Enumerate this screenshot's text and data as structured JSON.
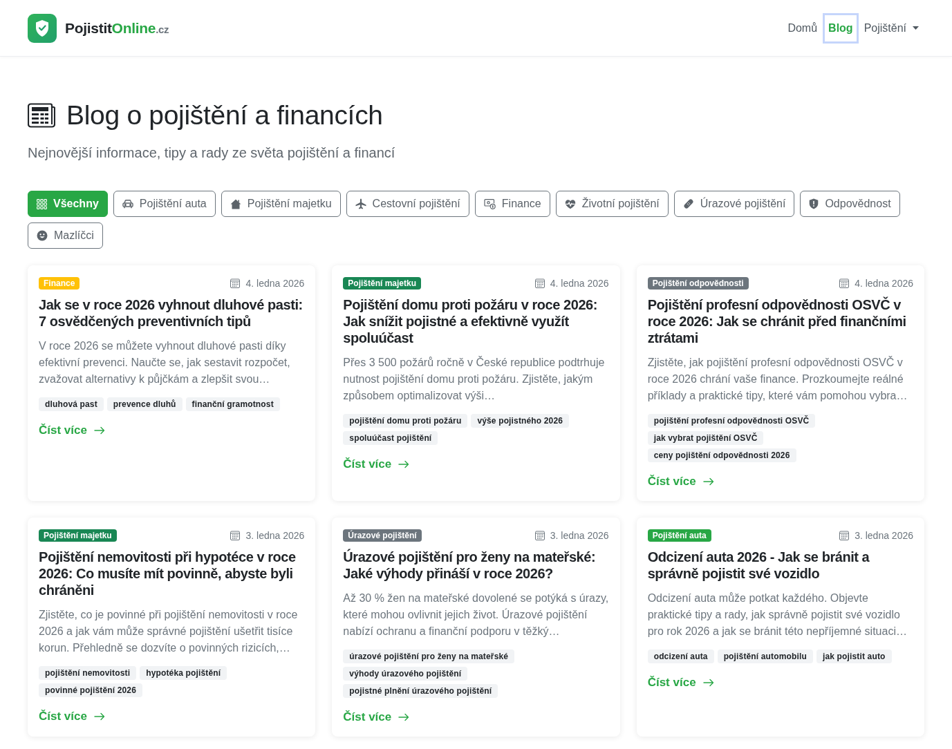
{
  "header": {
    "logo": {
      "parts": [
        {
          "text": "Pojistit",
          "kind": "plain"
        },
        {
          "text": "Online",
          "kind": "accent"
        },
        {
          "text": ".cz",
          "kind": "suffix"
        }
      ]
    },
    "nav": [
      {
        "label": "Domů",
        "kind": "link",
        "selected": false
      },
      {
        "label": "Blog",
        "kind": "link",
        "selected": true
      },
      {
        "label": "Pojištění",
        "kind": "dropdown",
        "selected": false
      }
    ]
  },
  "page": {
    "title": "Blog o pojištění a financích",
    "subtitle": "Nejnovější informace, tipy a rady ze světa pojištění a financí"
  },
  "filters": [
    {
      "label": "Všechny",
      "selected": true
    },
    {
      "label": "Pojištění auta",
      "selected": false
    },
    {
      "label": "Pojištění majetku",
      "selected": false
    },
    {
      "label": "Cestovní pojištění",
      "selected": false
    },
    {
      "label": "Finance",
      "selected": false
    },
    {
      "label": "Životní pojištění",
      "selected": false
    },
    {
      "label": "Úrazové pojištění",
      "selected": false
    },
    {
      "label": "Odpovědnost",
      "selected": false
    },
    {
      "label": "Mazlíčci",
      "selected": false
    }
  ],
  "posts": [
    {
      "category": {
        "label": "Finance",
        "color": "#ffc107"
      },
      "date": "4. ledna 2026",
      "title": "Jak se v roce 2026 vyhnout dluhové pasti: 7 osvědčených preventivních tipů",
      "excerpt": "V roce 2026 se můžete vyhnout dluhové pasti díky efektivní prevenci. Naučte se, jak sestavit rozpočet, zvažovat alternativy k půjčkám a zlepšit svou…",
      "tags": [
        "dluhová past",
        "prevence dluhů",
        "finanční gramotnost"
      ],
      "link": "Číst více"
    },
    {
      "category": {
        "label": "Pojištění majetku",
        "color": "#198754"
      },
      "date": "4. ledna 2026",
      "title": "Pojištění domu proti požáru v roce 2026: Jak snížit pojistné a efektivně využít spoluúčast",
      "excerpt": "Přes 3 500 požárů ročně v České republice podtrhuje nutnost pojištění domu proti požáru. Zjistěte, jakým způsobem optimalizovat výši…",
      "tags": [
        "pojištění domu proti požáru",
        "výše pojistného 2026",
        "spoluúčast pojištění"
      ],
      "link": "Číst více"
    },
    {
      "category": {
        "label": "Pojištění odpovědnosti",
        "color": "#6c757d"
      },
      "date": "4. ledna 2026",
      "title": "Pojištění profesní odpovědnosti OSVČ v roce 2026: Jak se chránit před finančními ztrátami",
      "excerpt": "Zjistěte, jak pojištění profesní odpovědnosti OSVČ v roce 2026 chrání vaše finance. Prozkoumejte reálné příklady a praktické tipy, které vám pomohou vybra…",
      "tags": [
        "pojištění profesní odpovědnosti OSVČ",
        "jak vybrat pojištění OSVČ",
        "ceny pojištění odpovědnosti 2026"
      ],
      "link": "Číst více"
    },
    {
      "category": {
        "label": "Pojištění majetku",
        "color": "#198754"
      },
      "date": "3. ledna 2026",
      "title": "Pojištění nemovitosti při hypotéce v roce 2026: Co musíte mít povinně, abyste byli chráněni",
      "excerpt": "Zjistěte, co je povinné při pojištění nemovitosti v roce 2026 a jak vám může správné pojištění ušetřit tisíce korun. Přehledně se dozvíte o povinných rizicích,…",
      "tags": [
        "pojištění nemovitosti",
        "hypotéka pojištění",
        "povinné pojištění 2026"
      ],
      "link": "Číst více"
    },
    {
      "category": {
        "label": "Úrazové pojištění",
        "color": "#6c757d"
      },
      "date": "3. ledna 2026",
      "title": "Úrazové pojištění pro ženy na mateřské: Jaké výhody přináší v roce 2026?",
      "excerpt": "Až 30 % žen na mateřské dovolené se potýká s úrazy, které mohou ovlivnit jejich život. Úrazové pojištění nabízí ochranu a finanční podporu v těžký…",
      "tags": [
        "úrazové pojištění pro ženy na mateřské",
        "výhody úrazového pojištění",
        "pojistné plnění úrazového pojištění"
      ],
      "link": "Číst více"
    },
    {
      "category": {
        "label": "Pojištění auta",
        "color": "#28a745"
      },
      "date": "3. ledna 2026",
      "title": "Odcizení auta 2026 - Jak se bránit a správně pojistit své vozidlo",
      "excerpt": "Odcizení auta může potkat každého. Objevte praktické tipy a rady, jak správně pojistit své vozidlo pro rok 2026 a jak se bránit této nepříjemné situaci…",
      "tags": [
        "odcizení auta",
        "pojištění automobilu",
        "jak pojistit auto"
      ],
      "link": "Číst více"
    }
  ]
}
